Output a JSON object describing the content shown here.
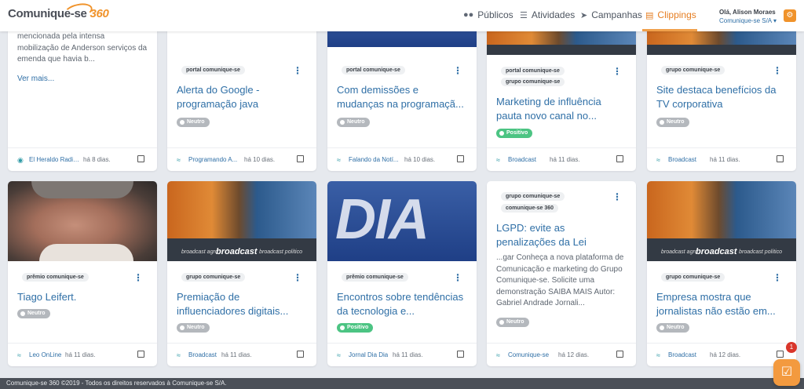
{
  "header": {
    "logo_text": "Comunique-se",
    "logo_num": "360",
    "nav": [
      {
        "label": "Públicos",
        "icon": "users-icon"
      },
      {
        "label": "Atividades",
        "icon": "list-icon"
      },
      {
        "label": "Campanhas",
        "icon": "send-icon"
      },
      {
        "label": "Clippings",
        "icon": "newspaper-icon",
        "active": true
      }
    ],
    "user_greeting": "Olá, Alison Moraes",
    "user_org": "Comunique-se S/A",
    "accent_color": "#f0932b"
  },
  "row1": [
    {
      "excerpt": "mencionada pela intensa mobilização de Anderson serviços da emenda que havia b...",
      "more": "Ver mais...",
      "source": "El Heraldo Radio...",
      "age": "há 8 dias."
    },
    {
      "tags": [
        "portal comunique-se"
      ],
      "title": "Alerta do Google - programação java",
      "sentiment": "Neutro",
      "source": "Programando A...",
      "age": "há 10 dias."
    },
    {
      "tags": [
        "portal comunique-se"
      ],
      "title": "Com demissões e mudanças na programaçã...",
      "sentiment": "Neutro",
      "source": "Falando da Notí...",
      "age": "há 10 dias."
    },
    {
      "tags": [
        "portal comunique-se",
        "grupo comunique-se"
      ],
      "title": "Marketing de influência pauta novo canal no...",
      "sentiment": "Positivo",
      "source": "Broadcast",
      "age": "há 11 dias."
    },
    {
      "tags": [
        "grupo comunique-se"
      ],
      "title": "Site destaca benefícios da TV corporativa",
      "sentiment": "Neutro",
      "source": "Broadcast",
      "age": "há 11 dias."
    }
  ],
  "row2": [
    {
      "tags": [
        "prêmio comunique-se"
      ],
      "title": "Tiago Leifert.",
      "sentiment": "Neutro",
      "source": "Leo OnLine",
      "age": "há 11 dias."
    },
    {
      "tags": [
        "grupo comunique-se"
      ],
      "title": "Premiação de influenciadores digitais...",
      "sentiment": "Neutro",
      "source": "Broadcast",
      "age": "há 11 dias."
    },
    {
      "tags": [
        "prêmio comunique-se"
      ],
      "title": "Encontros sobre tendências da tecnologia e...",
      "sentiment": "Positivo",
      "source": "Jornal Dia Dia",
      "age": "há 11 dias."
    },
    {
      "tags": [
        "grupo comunique-se",
        "comunique-se 360"
      ],
      "title": "LGPD: evite as penalizações da Lei",
      "excerpt": "...gar Conheça a nova plataforma de Comunicação e marketing do Grupo Comunique-se. Solicite uma demonstração SAIBA MAIS Autor: Gabriel Andrade Jornali...",
      "sentiment": "Neutro",
      "source": "Comunique-se",
      "age": "há 12 dias."
    },
    {
      "tags": [
        "grupo comunique-se"
      ],
      "title": "Empresa mostra que jornalistas não estão em...",
      "sentiment": "Neutro",
      "source": "Broadcast",
      "age": "há 12 dias."
    }
  ],
  "thumb_text": {
    "broadcast": "broadcast",
    "broadcast_left": "broadcast agro",
    "broadcast_right": "broadcast político",
    "dia": "DIA"
  },
  "chat": {
    "count": "1"
  },
  "footer_text": "Comunique-se 360 ©2019 - Todos os direitos reservados à Comunique-se S/A."
}
